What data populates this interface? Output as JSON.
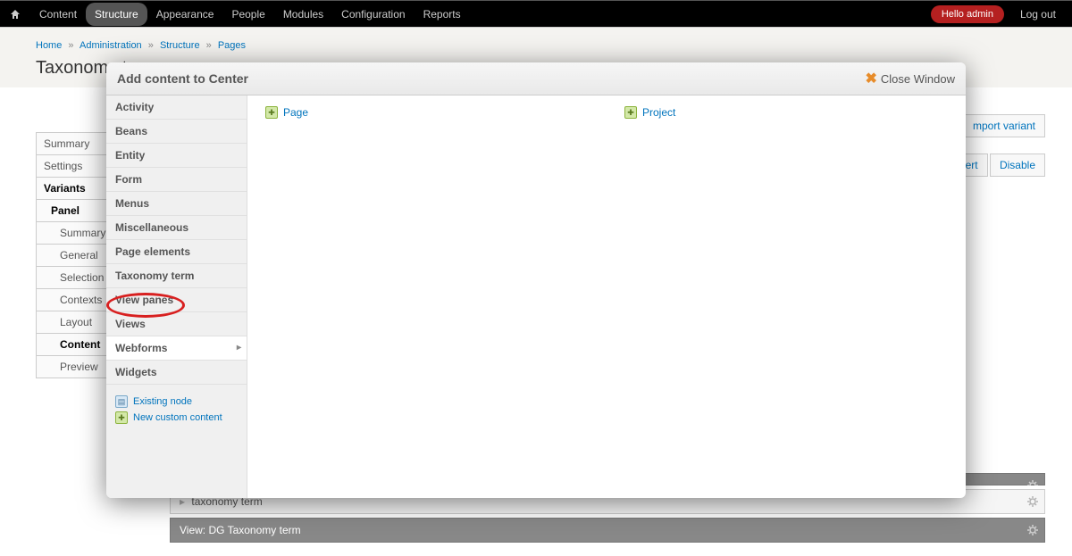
{
  "toolbar": {
    "items": [
      "Content",
      "Structure",
      "Appearance",
      "People",
      "Modules",
      "Configuration",
      "Reports"
    ],
    "active": "Structure",
    "hello": "Hello admin",
    "logout": "Log out"
  },
  "breadcrumb": {
    "items": [
      "Home",
      "Administration",
      "Structure",
      "Pages"
    ]
  },
  "page": {
    "title": "Taxonomy te"
  },
  "side_tabs": [
    {
      "label": "Summary",
      "indent": 0
    },
    {
      "label": "Settings",
      "indent": 0
    },
    {
      "label": "Variants",
      "indent": 0,
      "active": true
    },
    {
      "label": "Panel",
      "indent": 1,
      "active": true
    },
    {
      "label": "Summary",
      "indent": 2
    },
    {
      "label": "General",
      "indent": 2
    },
    {
      "label": "Selection r",
      "indent": 2
    },
    {
      "label": "Contexts",
      "indent": 2
    },
    {
      "label": "Layout",
      "indent": 2
    },
    {
      "label": "Content",
      "indent": 2,
      "active": true
    },
    {
      "label": "Preview",
      "indent": 2
    }
  ],
  "right_actions1": [
    "mport variant"
  ],
  "right_actions2": [
    "vert",
    "Disable"
  ],
  "panel_rows": [
    {
      "label": "",
      "gear": true,
      "light": false
    },
    {
      "label": "taxonomy term",
      "gear": true,
      "light": true,
      "arrow": true
    },
    {
      "label": "View: DG Taxonomy term",
      "gear": true,
      "light": false
    }
  ],
  "modal": {
    "title": "Add content to Center",
    "close": "Close Window",
    "categories": [
      "Activity",
      "Beans",
      "Entity",
      "Form",
      "Menus",
      "Miscellaneous",
      "Page elements",
      "Taxonomy term",
      "View panes",
      "Views",
      "Webforms",
      "Widgets"
    ],
    "highlighted": "Webforms",
    "footer_links": [
      {
        "icon": "blue",
        "label": "Existing node"
      },
      {
        "icon": "green",
        "label": "New custom content"
      }
    ],
    "content_links": [
      {
        "icon": "green",
        "label": "Page"
      },
      {
        "icon": "green",
        "label": "Project"
      }
    ]
  }
}
